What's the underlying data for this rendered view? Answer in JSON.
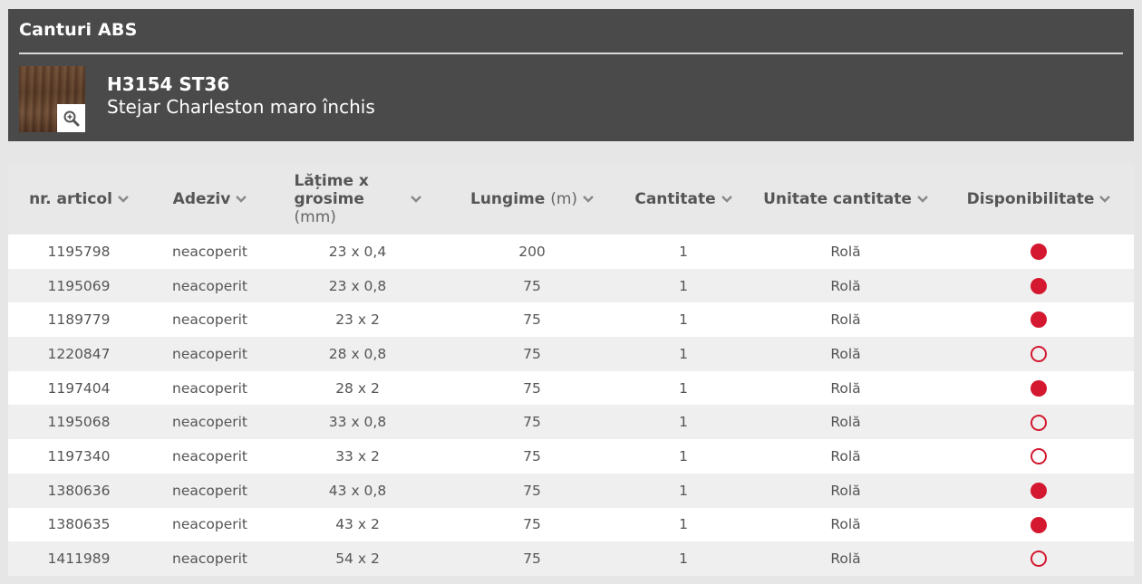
{
  "section_title": "Canturi ABS",
  "product": {
    "code": "H3154 ST36",
    "name": "Stejar Charleston maro închis"
  },
  "colors": {
    "header_bg": "#4a4a4a",
    "availability": "#d3182f"
  },
  "icons": {
    "zoom": "magnifier-plus-icon",
    "sort": "chevron-down-icon"
  },
  "table": {
    "columns": [
      {
        "label": "nr. articol",
        "unit": ""
      },
      {
        "label": "Adeziv",
        "unit": ""
      },
      {
        "label": "Lățime x grosime",
        "unit": "(mm)"
      },
      {
        "label": "Lungime",
        "unit": "(m)"
      },
      {
        "label": "Cantitate",
        "unit": ""
      },
      {
        "label": "Unitate cantitate",
        "unit": ""
      },
      {
        "label": "Disponibilitate",
        "unit": ""
      }
    ],
    "rows": [
      {
        "article": "1195798",
        "adhesive": "neacoperit",
        "size": "23 x 0,4",
        "length": "200",
        "qty": "1",
        "unit": "Rolă",
        "available": true
      },
      {
        "article": "1195069",
        "adhesive": "neacoperit",
        "size": "23 x 0,8",
        "length": "75",
        "qty": "1",
        "unit": "Rolă",
        "available": true
      },
      {
        "article": "1189779",
        "adhesive": "neacoperit",
        "size": "23 x 2",
        "length": "75",
        "qty": "1",
        "unit": "Rolă",
        "available": true
      },
      {
        "article": "1220847",
        "adhesive": "neacoperit",
        "size": "28 x 0,8",
        "length": "75",
        "qty": "1",
        "unit": "Rolă",
        "available": false
      },
      {
        "article": "1197404",
        "adhesive": "neacoperit",
        "size": "28 x 2",
        "length": "75",
        "qty": "1",
        "unit": "Rolă",
        "available": true
      },
      {
        "article": "1195068",
        "adhesive": "neacoperit",
        "size": "33 x 0,8",
        "length": "75",
        "qty": "1",
        "unit": "Rolă",
        "available": false
      },
      {
        "article": "1197340",
        "adhesive": "neacoperit",
        "size": "33 x 2",
        "length": "75",
        "qty": "1",
        "unit": "Rolă",
        "available": false
      },
      {
        "article": "1380636",
        "adhesive": "neacoperit",
        "size": "43 x 0,8",
        "length": "75",
        "qty": "1",
        "unit": "Rolă",
        "available": true
      },
      {
        "article": "1380635",
        "adhesive": "neacoperit",
        "size": "43 x 2",
        "length": "75",
        "qty": "1",
        "unit": "Rolă",
        "available": true
      },
      {
        "article": "1411989",
        "adhesive": "neacoperit",
        "size": "54 x 2",
        "length": "75",
        "qty": "1",
        "unit": "Rolă",
        "available": false
      }
    ]
  }
}
